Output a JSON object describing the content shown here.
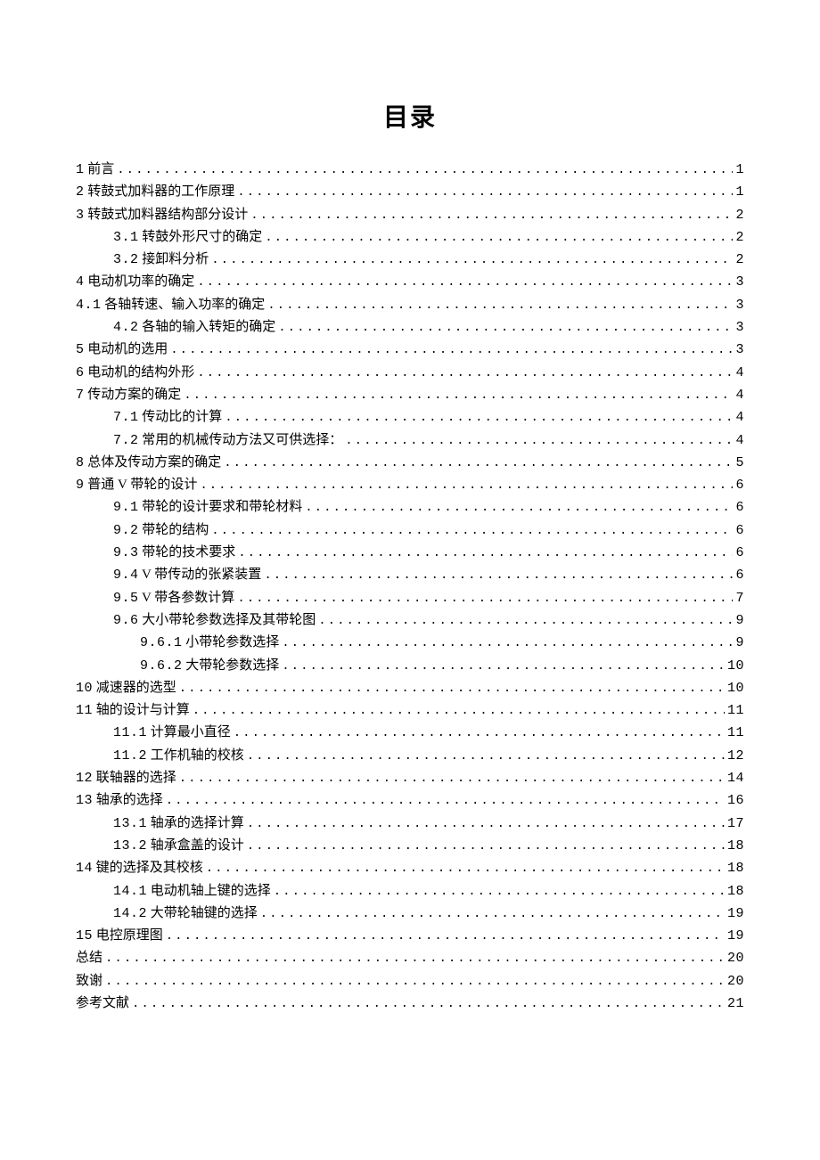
{
  "title": "目录",
  "toc": [
    {
      "level": 0,
      "label": "1 前言",
      "page": "1"
    },
    {
      "level": 0,
      "label": "2 转鼓式加料器的工作原理",
      "page": "1"
    },
    {
      "level": 0,
      "label": "3 转鼓式加料器结构部分设计",
      "page": "2"
    },
    {
      "level": 1,
      "label": "3.1 转鼓外形尺寸的确定",
      "page": "2"
    },
    {
      "level": 1,
      "label": "3.2 接卸料分析",
      "page": "2"
    },
    {
      "level": 0,
      "label": "4 电动机功率的确定",
      "page": "3"
    },
    {
      "level": 0,
      "label": "4.1 各轴转速、输入功率的确定",
      "page": "3"
    },
    {
      "level": 1,
      "label": "4.2 各轴的输入转矩的确定",
      "page": "3"
    },
    {
      "level": 0,
      "label": "5 电动机的选用",
      "page": "3"
    },
    {
      "level": 0,
      "label": "6 电动机的结构外形",
      "page": "4"
    },
    {
      "level": 0,
      "label": "7 传动方案的确定",
      "page": "4"
    },
    {
      "level": 1,
      "label": "7.1 传动比的计算",
      "page": "4"
    },
    {
      "level": 1,
      "label": "7.2 常用的机械传动方法又可供选择：",
      "page": "4"
    },
    {
      "level": 0,
      "label": "8 总体及传动方案的确定",
      "page": "5"
    },
    {
      "level": 0,
      "label": "9 普通 V 带轮的设计",
      "page": "6"
    },
    {
      "level": 1,
      "label": "9.1 带轮的设计要求和带轮材料",
      "page": "6"
    },
    {
      "level": 1,
      "label": "9.2 带轮的结构",
      "page": "6"
    },
    {
      "level": 1,
      "label": "9.3 带轮的技术要求",
      "page": "6"
    },
    {
      "level": 1,
      "label": "9.4 V 带传动的张紧装置",
      "page": "6"
    },
    {
      "level": 1,
      "label": "9.5 V 带各参数计算",
      "page": "7"
    },
    {
      "level": 1,
      "label": "9.6 大小带轮参数选择及其带轮图",
      "page": "9"
    },
    {
      "level": 2,
      "label": "9.6.1 小带轮参数选择",
      "page": "9"
    },
    {
      "level": 2,
      "label": "9.6.2 大带轮参数选择",
      "page": "10"
    },
    {
      "level": 0,
      "label": "10 减速器的选型",
      "page": "10"
    },
    {
      "level": 0,
      "label": "11 轴的设计与计算",
      "page": "11"
    },
    {
      "level": 1,
      "label": "11.1 计算最小直径",
      "page": "11"
    },
    {
      "level": 1,
      "label": "11.2 工作机轴的校核",
      "page": "12"
    },
    {
      "level": 0,
      "label": "12 联轴器的选择",
      "page": "14"
    },
    {
      "level": 0,
      "label": "13 轴承的选择",
      "page": "16"
    },
    {
      "level": 1,
      "label": "13.1 轴承的选择计算",
      "page": "17"
    },
    {
      "level": 1,
      "label": "13.2 轴承盒盖的设计",
      "page": "18"
    },
    {
      "level": 0,
      "label": "14 键的选择及其校核",
      "page": "18"
    },
    {
      "level": 1,
      "label": "14.1 电动机轴上键的选择",
      "page": "18"
    },
    {
      "level": 1,
      "label": "14.2 大带轮轴键的选择",
      "page": "19"
    },
    {
      "level": 0,
      "label": "15 电控原理图",
      "page": "19"
    },
    {
      "level": 0,
      "label": "总结",
      "page": "20"
    },
    {
      "level": 0,
      "label": "致谢",
      "page": "20"
    },
    {
      "level": 0,
      "label": "参考文献",
      "page": "21"
    }
  ]
}
